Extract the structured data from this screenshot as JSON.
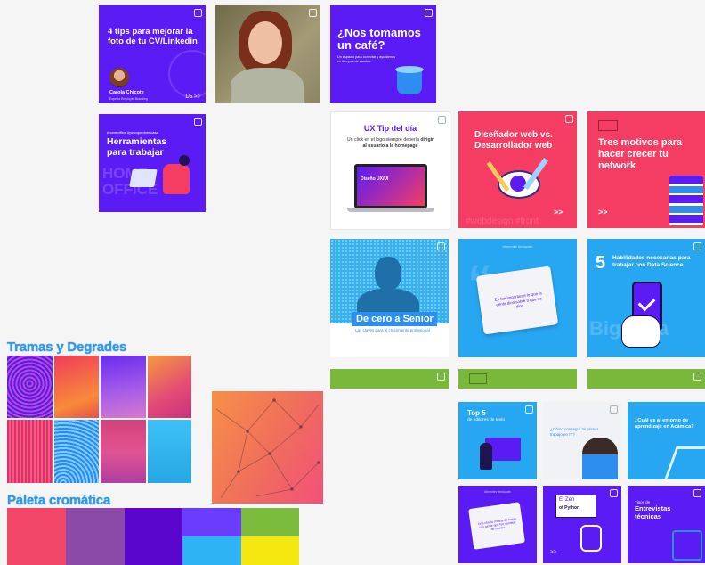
{
  "posts": {
    "cv_tips": {
      "title": "4 tips para mejorar la foto de tu CV/Linkedin",
      "author": "Carola Chicote",
      "author_role": "Experta Employer Branding",
      "pager": "1/5 >>"
    },
    "cafe": {
      "title": "¿Nos tomamos un café?",
      "subtitle": "Un espacio para conectar y ayudarnos en tiempos de cambio."
    },
    "homeoffice": {
      "tags": "#homeoffice #yonoquedoencasa",
      "title": "Herramientas para trabajar",
      "watermark": "HOME OFFICE"
    },
    "ux_tip": {
      "title": "UX Tip del día",
      "body_pre": "Un click en el logo siempre debería ",
      "body_strong": "dirigir al usuario a la homepage",
      "screen_text": "Diseño UX/UI"
    },
    "designer_vs_dev": {
      "title": "Diseñador web vs. Desarrollador web",
      "watermark": "#webdesign #front",
      "arrows": ">>"
    },
    "network": {
      "title": "Tres motivos para hacer crecer tu network",
      "arrows": ">>"
    },
    "senior": {
      "title": "De cero a Senior",
      "subtitle": "Las claves para el crecimiento profesional"
    },
    "empanada": {
      "tag": "#bemdev #educate",
      "message": "Es tan importante lo que la gente dice sobre ti que no dice"
    },
    "data_science": {
      "number": "5",
      "title": "Habilidades necesarias para trabajar con Data Science",
      "watermark": "Big Data"
    },
    "top5": {
      "number": "Top 5",
      "title": "de editores de texto"
    },
    "first_job": {
      "title": "¿Cómo conseguí mi primer trabajo en IT?"
    },
    "learning": {
      "title": "¿Cuál es al entorno de aprendizaje en Acámica?"
    },
    "card_small": {
      "tag": "#bemdev #educate",
      "message": "Una charla creada de horas con gente que fue cambiar de carrera"
    },
    "zen": {
      "title": "El Zen",
      "subtitle": "of Python"
    },
    "interviews": {
      "pre": "Tipos de",
      "title": "Entrevistas técnicas"
    }
  },
  "sections": {
    "patterns_title": "Tramas y Degrades",
    "palette_title": "Paleta cromática"
  },
  "colors": {
    "violet": "#5a1bf5",
    "pink": "#f53d63",
    "blue": "#27a6f2",
    "purple": "#8747a6",
    "deep_violet": "#5b06c9",
    "lavender": "#6e44ff",
    "green": "#7ab83b",
    "sky": "#29b6f6",
    "yellow": "#f2e20c"
  },
  "palette": [
    "#f3476a",
    "#8b4aa8",
    "#5a06cc",
    "#6a3dfe",
    "#7cbc3c",
    "#2eb3f4",
    "#f4e60f"
  ]
}
